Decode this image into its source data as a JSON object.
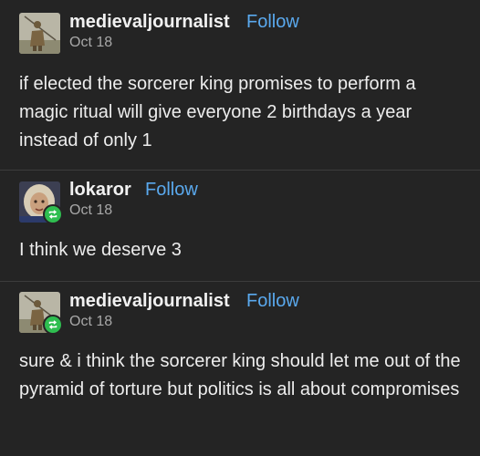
{
  "posts": [
    {
      "username": "medievaljournalist",
      "follow_label": "Follow",
      "date": "Oct 18",
      "reblogged": false,
      "text": "if elected the sorcerer king promises to perform a magic ritual will give everyone 2 birthdays a year instead of only 1"
    },
    {
      "username": "lokaror",
      "follow_label": "Follow",
      "date": "Oct 18",
      "reblogged": true,
      "text": "I think we deserve 3"
    },
    {
      "username": "medievaljournalist",
      "follow_label": "Follow",
      "date": "Oct 18",
      "reblogged": true,
      "text": "sure & i think the sorcerer king should let me out of the pyramid of torture but politics is all about compromises"
    }
  ],
  "colors": {
    "background": "#242424",
    "follow": "#5aa9ee",
    "reblog_badge": "#2fbe50"
  },
  "icons": {
    "avatar_1": "knight-statue-avatar",
    "avatar_2": "painted-portrait-avatar",
    "avatar_3": "knight-statue-avatar",
    "reblog": "reblog-icon"
  }
}
